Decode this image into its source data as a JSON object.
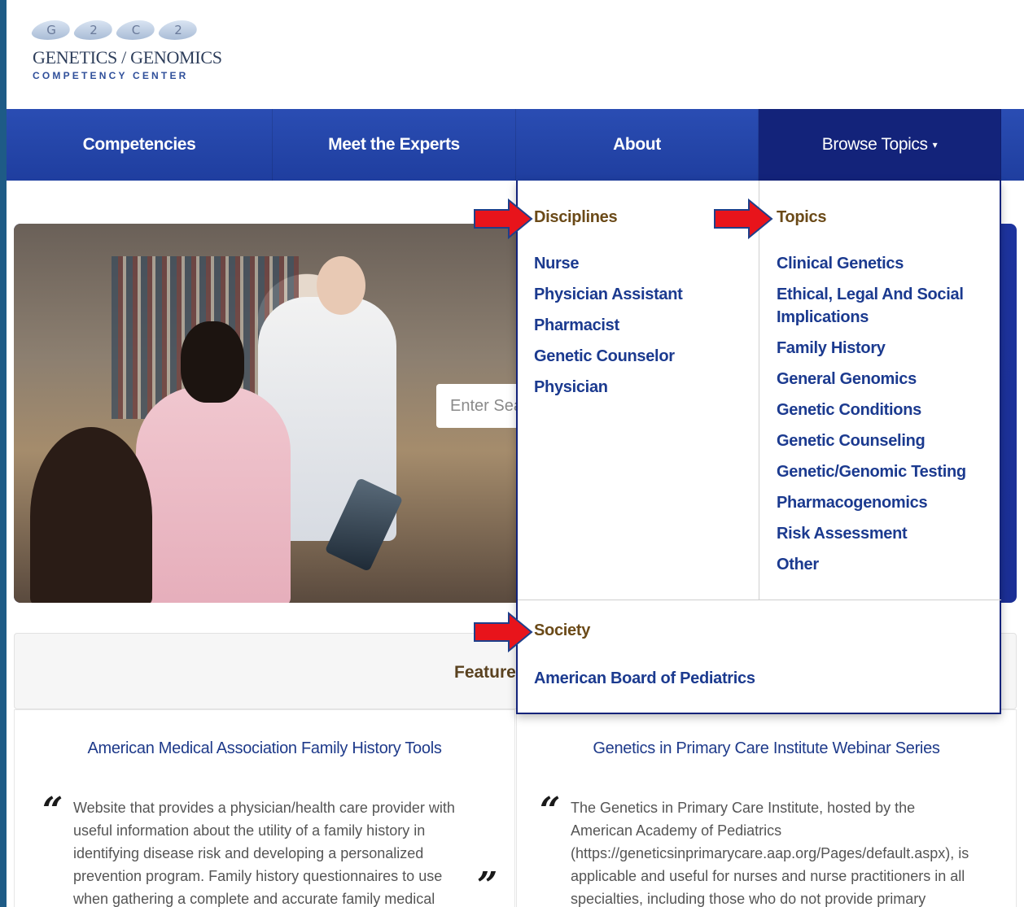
{
  "logo": {
    "badges": [
      "G",
      "2",
      "C",
      "2"
    ],
    "title": "GENETICS / GENOMICS",
    "subtitle": "COMPETENCY CENTER"
  },
  "nav": {
    "items": [
      {
        "label": "Competencies"
      },
      {
        "label": "Meet the Experts"
      },
      {
        "label": "About"
      },
      {
        "label": "Browse Topics",
        "caret": "▾"
      }
    ]
  },
  "hero": {
    "search_placeholder": "Enter Sear"
  },
  "dropdown": {
    "disciplines": {
      "heading": "Disciplines",
      "items": [
        "Nurse",
        "Physician Assistant",
        "Pharmacist",
        "Genetic Counselor",
        "Physician"
      ]
    },
    "topics": {
      "heading": "Topics",
      "items": [
        "Clinical Genetics",
        "Ethical, Legal And Social Implications",
        "Family History",
        "General Genomics",
        "Genetic Conditions",
        "Genetic Counseling",
        "Genetic/Genomic Testing",
        "Pharmacogenomics",
        "Risk Assessment",
        "Other"
      ]
    },
    "society": {
      "heading": "Society",
      "items": [
        "American Board of Pediatrics"
      ]
    }
  },
  "featured": {
    "label": "Featured"
  },
  "cards": [
    {
      "title": "American Medical Association Family History Tools",
      "quote_open": "“",
      "quote_close": "”",
      "text": "Website that provides a physician/health care provider with useful information about the utility of a family history in identifying disease risk and developing a personalized prevention program. Family history questionnaires to use when gathering a complete and accurate family medical"
    },
    {
      "title": "Genetics in Primary Care Institute Webinar Series",
      "quote_open": "“",
      "text": "The Genetics in Primary Care Institute, hosted by the American Academy of Pediatrics (https://geneticsinprimarycare.aap.org/Pages/default.aspx), is applicable and useful for nurses and nurse practitioners in all specialties, including those who do not provide primary"
    }
  ],
  "colors": {
    "nav_bg": "#2446b0",
    "nav_active": "#13237a",
    "heading_brown": "#6b4a18",
    "link_blue": "#1b3a8f",
    "arrow_red": "#e8141b",
    "arrow_outline": "#1e3f8a"
  }
}
